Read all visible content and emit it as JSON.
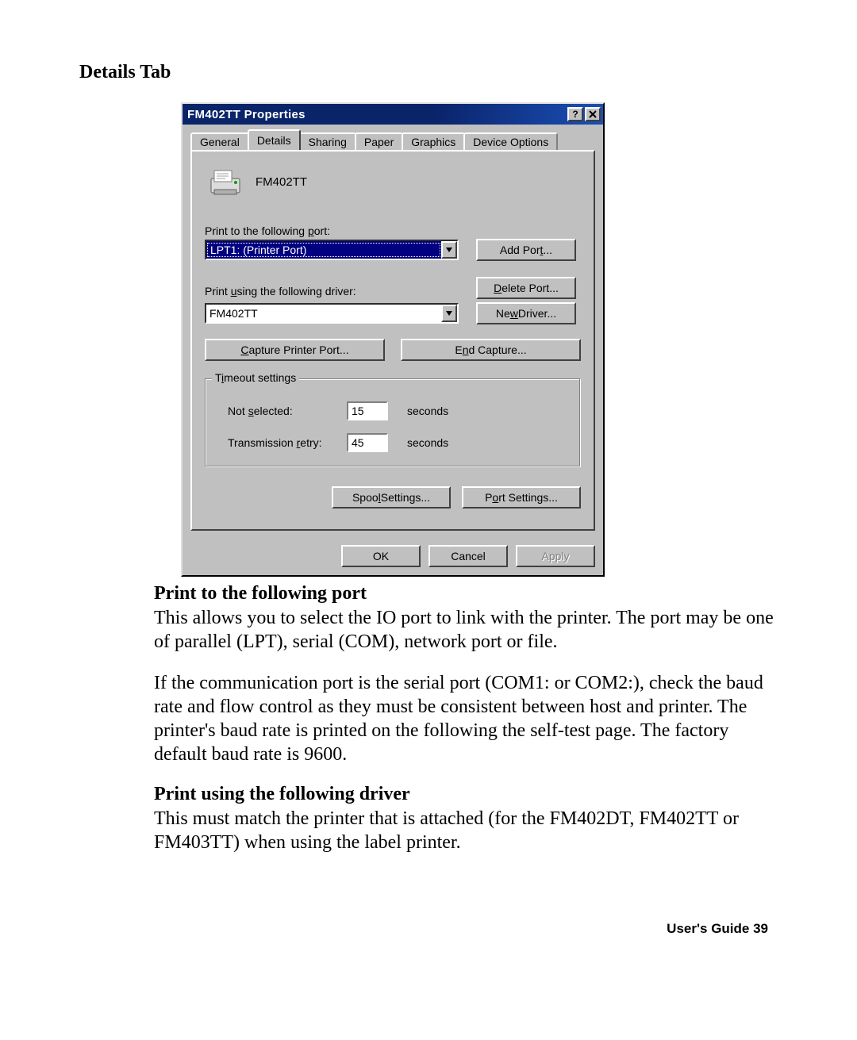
{
  "headings": {
    "details_tab": "Details Tab",
    "port_heading": "Print to the following port",
    "driver_heading": "Print using the following driver"
  },
  "paragraphs": {
    "port_p1": "This allows you to select the IO port to link with the printer. The port may be one of parallel (LPT), serial (COM), network port or file.",
    "port_p2": "If the communication port is the serial port (COM1: or COM2:), check the baud rate and flow control as they must be consistent between host and printer.  The printer's baud rate is printed on the following the self-test page.  The factory default baud rate is 9600.",
    "driver_p1": "This must match the printer that is attached  (for the FM402DT, FM402TT or FM403TT) when using the label printer."
  },
  "footer": "User's Guide 39",
  "dialog": {
    "title": "FM402TT Properties",
    "tabs": {
      "general": "General",
      "details": "Details",
      "sharing": "Sharing",
      "paper": "Paper",
      "graphics": "Graphics",
      "device_options": "Device Options"
    },
    "printer_name": "FM402TT",
    "labels": {
      "port": "Print to the following port:",
      "driver": "Print using the following driver:",
      "timeout_group": "Timeout settings",
      "not_selected": "Not selected:",
      "transmission_retry": "Transmission retry:",
      "seconds": "seconds"
    },
    "values": {
      "port_selected": "LPT1:  (Printer Port)",
      "driver_selected": "FM402TT",
      "not_selected_value": "15",
      "transmission_retry_value": "45"
    },
    "buttons": {
      "add_port": "Add Port...",
      "delete_port": "Delete Port...",
      "new_driver": "New Driver...",
      "capture_port": "Capture Printer Port...",
      "end_capture": "End Capture...",
      "spool_settings": "Spool Settings...",
      "port_settings": "Port Settings...",
      "ok": "OK",
      "cancel": "Cancel",
      "apply": "Apply"
    }
  }
}
